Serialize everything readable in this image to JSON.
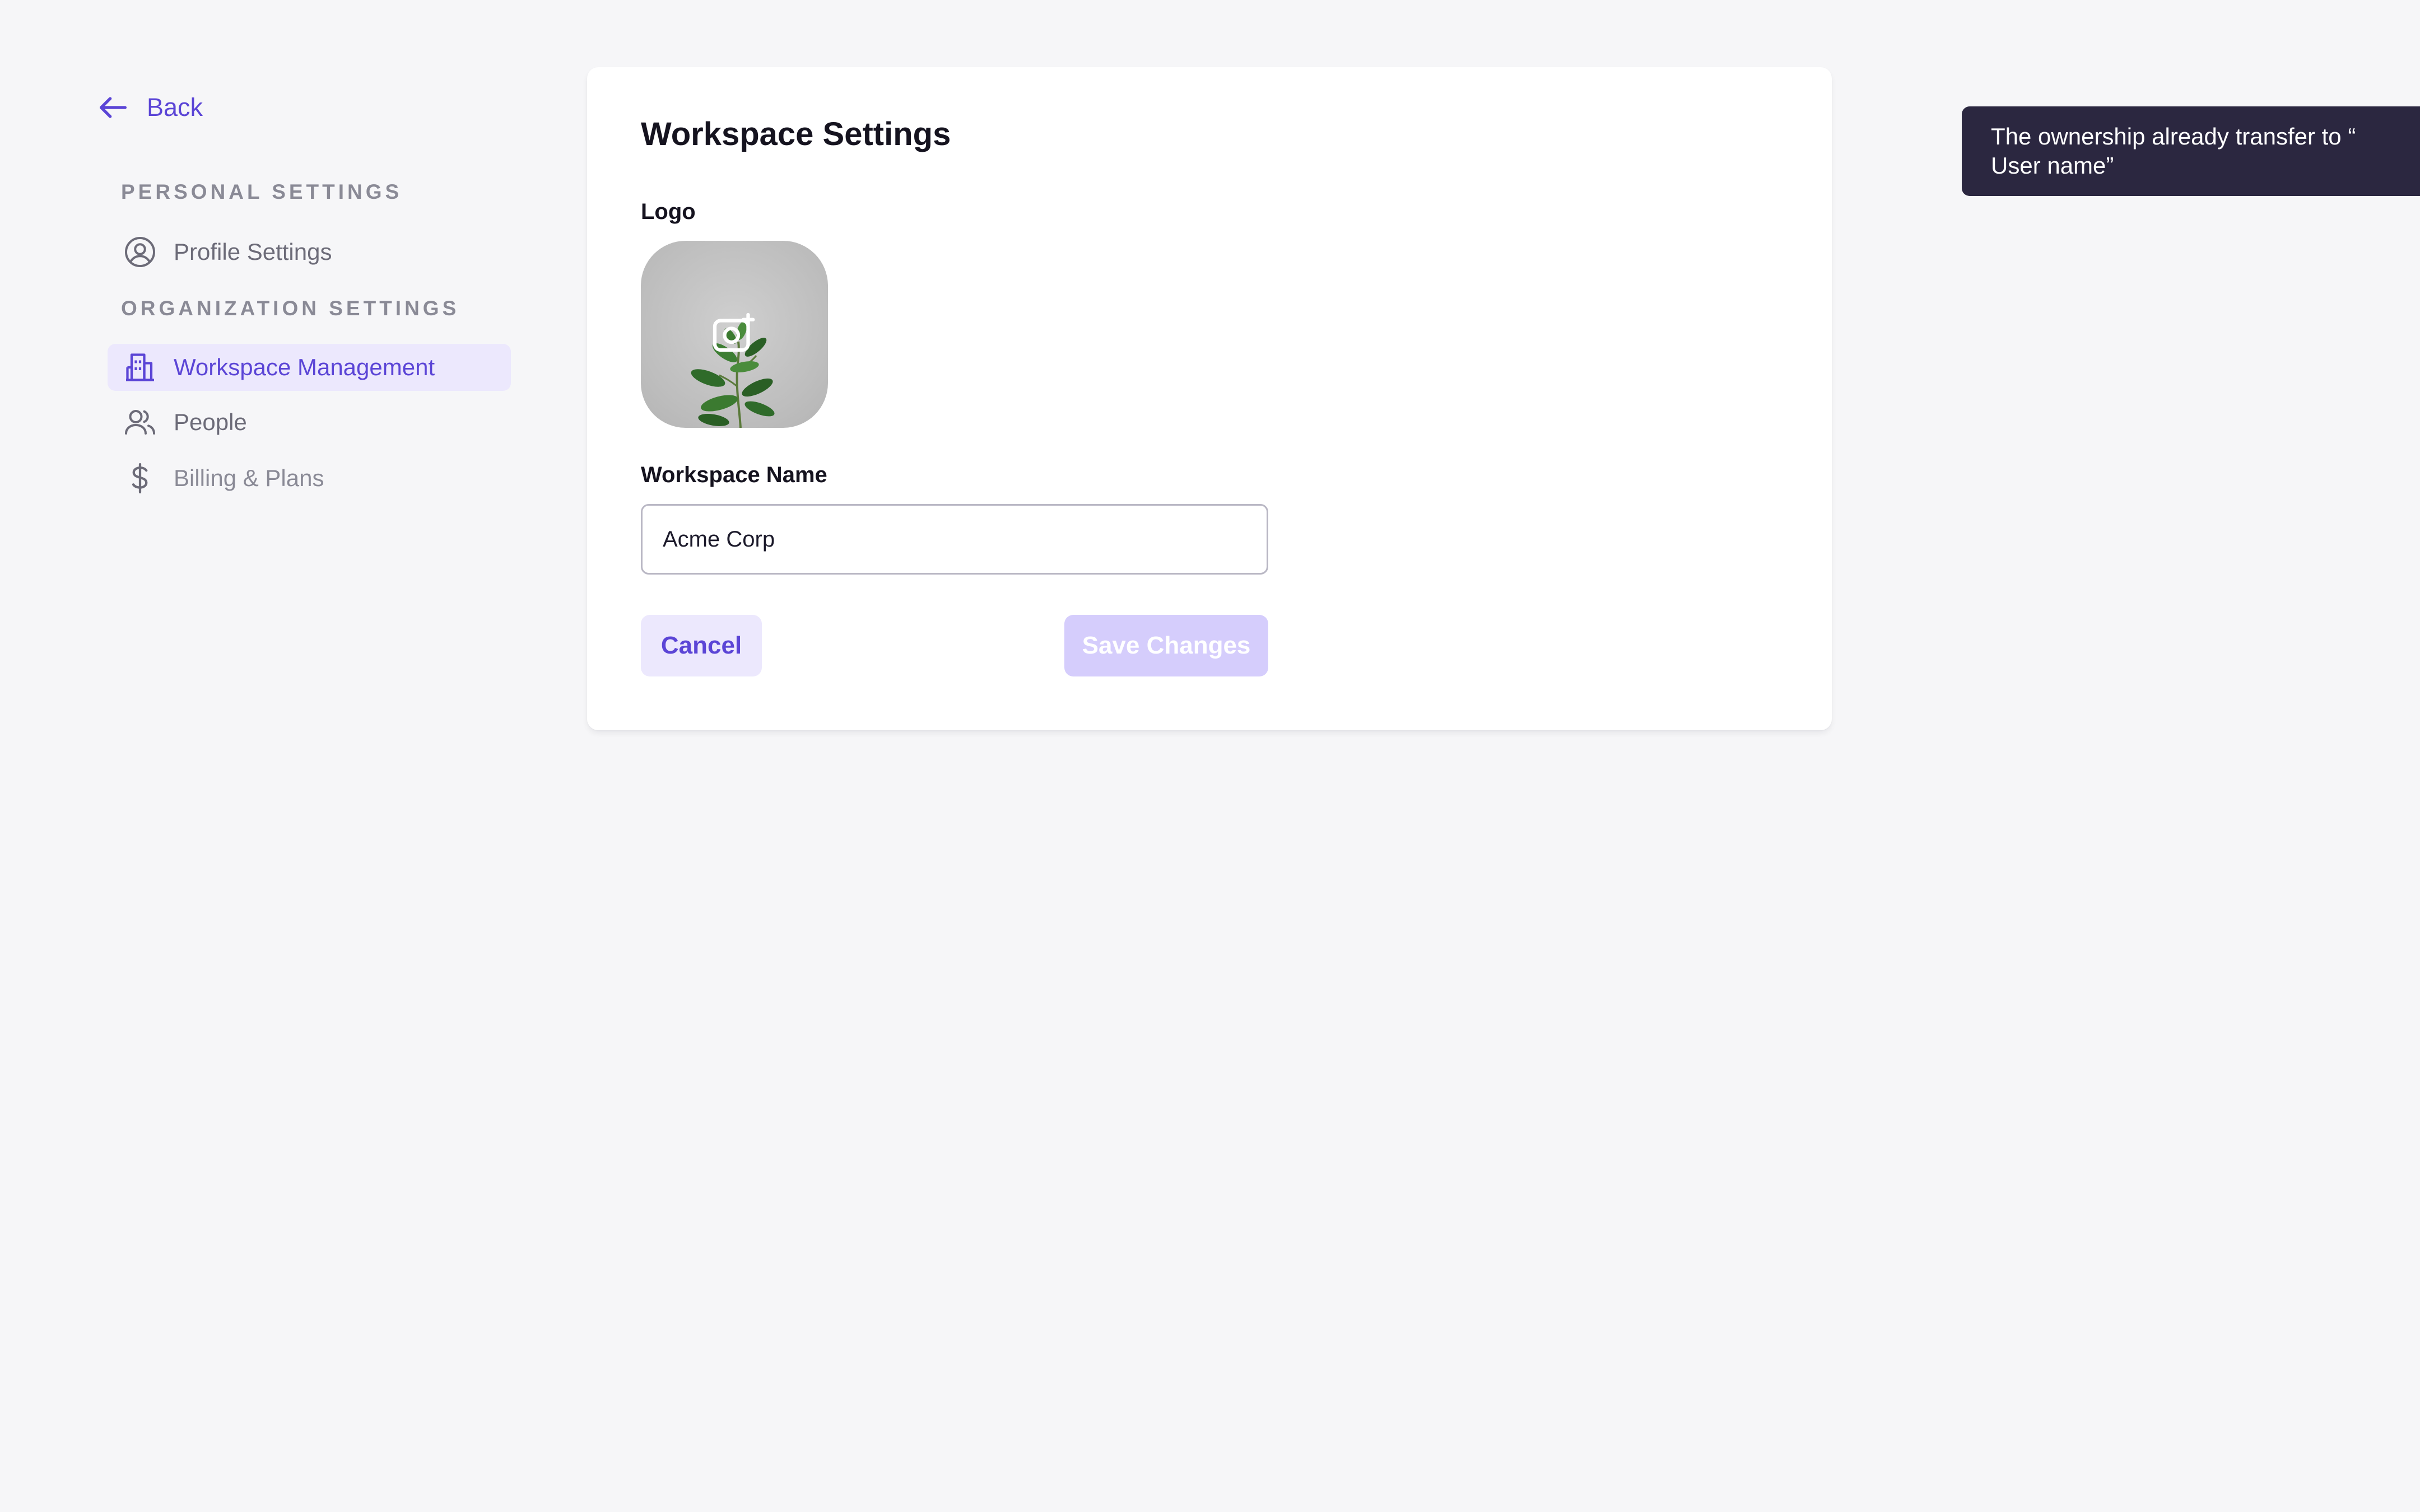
{
  "sidebar": {
    "back_label": "Back",
    "personal_header": "PERSONAL SETTINGS",
    "org_header": "ORGANIZATION SETTINGS",
    "items": [
      {
        "label": "Profile Settings",
        "icon": "user-circle-icon",
        "active": false
      },
      {
        "label": "Workspace Management",
        "icon": "building-icon",
        "active": true
      },
      {
        "label": "People",
        "icon": "people-icon",
        "active": false
      },
      {
        "label": "Billing & Plans",
        "icon": "dollar-icon",
        "active": false
      }
    ]
  },
  "card": {
    "title": "Workspace Settings",
    "logo_label": "Logo",
    "logo_image": "plant-photo",
    "logo_overlay_icon": "camera-plus-icon",
    "name_label": "Workspace Name",
    "name_value": "Acme Corp",
    "cancel_label": "Cancel",
    "save_label": "Save Changes"
  },
  "toast": {
    "message": "The ownership already transfer to “ User name”"
  },
  "colors": {
    "accent": "#5b45d6",
    "active_bg": "#ece8fd",
    "save_disabled_bg": "#d5cdfc",
    "toast_bg": "#2b2740",
    "page_bg": "#f6f6f8"
  }
}
